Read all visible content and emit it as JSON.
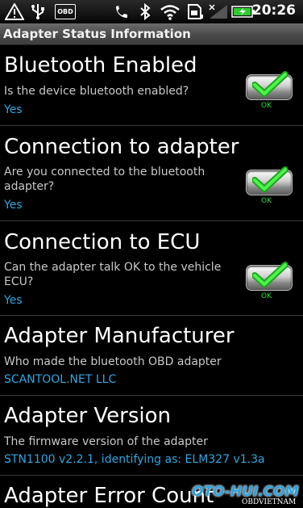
{
  "status_bar": {
    "time": "20:26",
    "obd_badge": "OBD",
    "icons": [
      "warning-icon",
      "usb-icon",
      "obd-icon",
      "missed-call-icon",
      "bluetooth-icon",
      "wifi-icon",
      "sd-card-icon",
      "signal-icon",
      "battery-charging-icon"
    ]
  },
  "title_bar": {
    "title": "Adapter Status Information"
  },
  "items": [
    {
      "title": "Bluetooth Enabled",
      "description": "Is the device bluetooth enabled?",
      "value": "Yes",
      "check_label": "OK"
    },
    {
      "title": "Connection to adapter",
      "description": "Are you connected to the bluetooth adapter?",
      "value": "Yes",
      "check_label": "OK"
    },
    {
      "title": "Connection to ECU",
      "description": "Can the adapter talk OK to the vehicle ECU?",
      "value": "Yes",
      "check_label": "OK"
    },
    {
      "title": "Adapter Manufacturer",
      "description": "Who made the bluetooth OBD adapter",
      "value": "SCANTOOL.NET LLC"
    },
    {
      "title": "Adapter Version",
      "description": "The firmware version of the adapter",
      "value": "STN1100 v2.2.1, identifying as: ELM327 v1.3a"
    },
    {
      "title": "Adapter Error Count"
    }
  ],
  "watermark": {
    "main": "OTO-HUI.COM",
    "sub": "OBDVIETNAM"
  },
  "colors": {
    "value_blue": "#2fa7e0",
    "check_green": "#2ee02e",
    "background": "#000000"
  }
}
